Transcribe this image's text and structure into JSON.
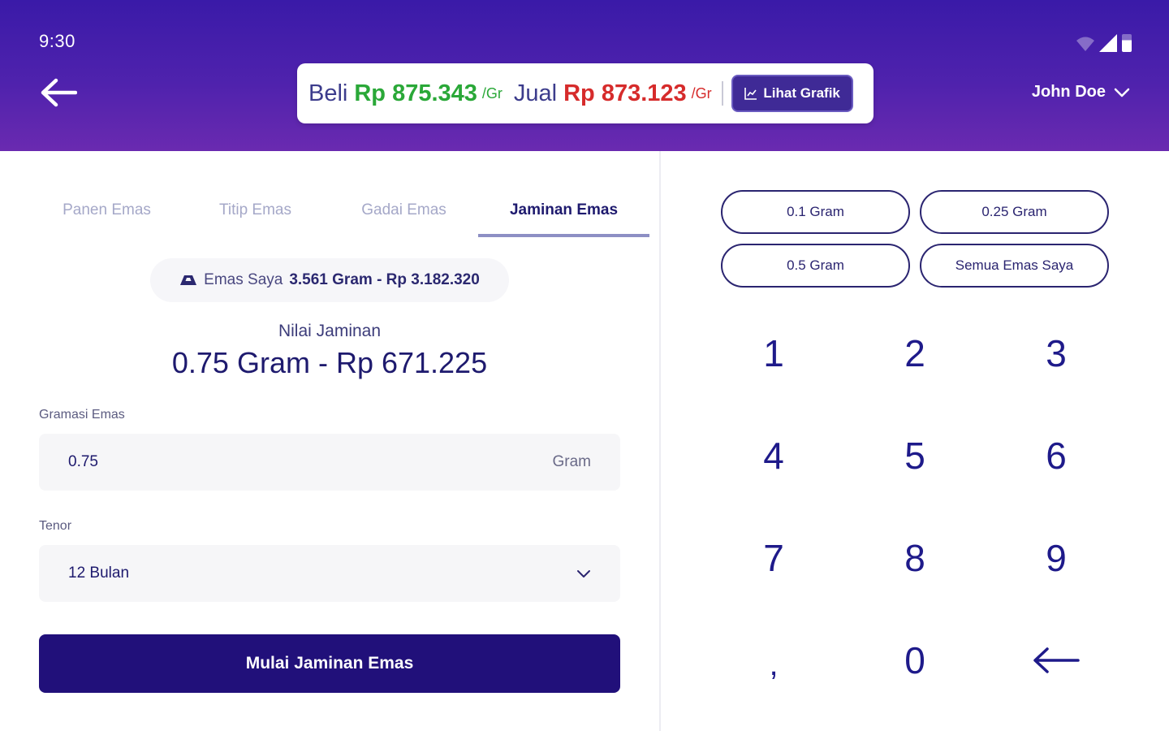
{
  "status": {
    "time": "9:30"
  },
  "header": {
    "back_icon": "arrow-left-icon",
    "price": {
      "buy_label": "Beli",
      "buy_value": "Rp 875.343",
      "buy_unit": "/Gr",
      "sell_label": "Jual",
      "sell_value": "Rp 873.123",
      "sell_unit": "/Gr",
      "chart_button": "Lihat Grafik"
    },
    "user": {
      "name": "John Doe"
    }
  },
  "tabs": [
    {
      "label": "Panen Emas",
      "active": false
    },
    {
      "label": "Titip Emas",
      "active": false
    },
    {
      "label": "Gadai Emas",
      "active": false
    },
    {
      "label": "Jaminan Emas",
      "active": true
    }
  ],
  "my_gold": {
    "label": "Emas Saya",
    "value": "3.561 Gram - Rp 3.182.320"
  },
  "collateral": {
    "label": "Nilai Jaminan",
    "value": "0.75 Gram - Rp 671.225"
  },
  "gram_field": {
    "label": "Gramasi Emas",
    "value": "0.75",
    "unit": "Gram"
  },
  "tenor_field": {
    "label": "Tenor",
    "value": "12 Bulan"
  },
  "submit_button": "Mulai Jaminan Emas",
  "quick_amounts": [
    "0.1 Gram",
    "0.25 Gram",
    "0.5 Gram",
    "Semua Emas Saya"
  ],
  "keypad": [
    "1",
    "2",
    "3",
    "4",
    "5",
    "6",
    "7",
    "8",
    "9",
    ",",
    "0"
  ],
  "colors": {
    "header": "#4f22ad",
    "buy": "#2aa838",
    "sell": "#d62b2b",
    "primary": "#21107a"
  }
}
